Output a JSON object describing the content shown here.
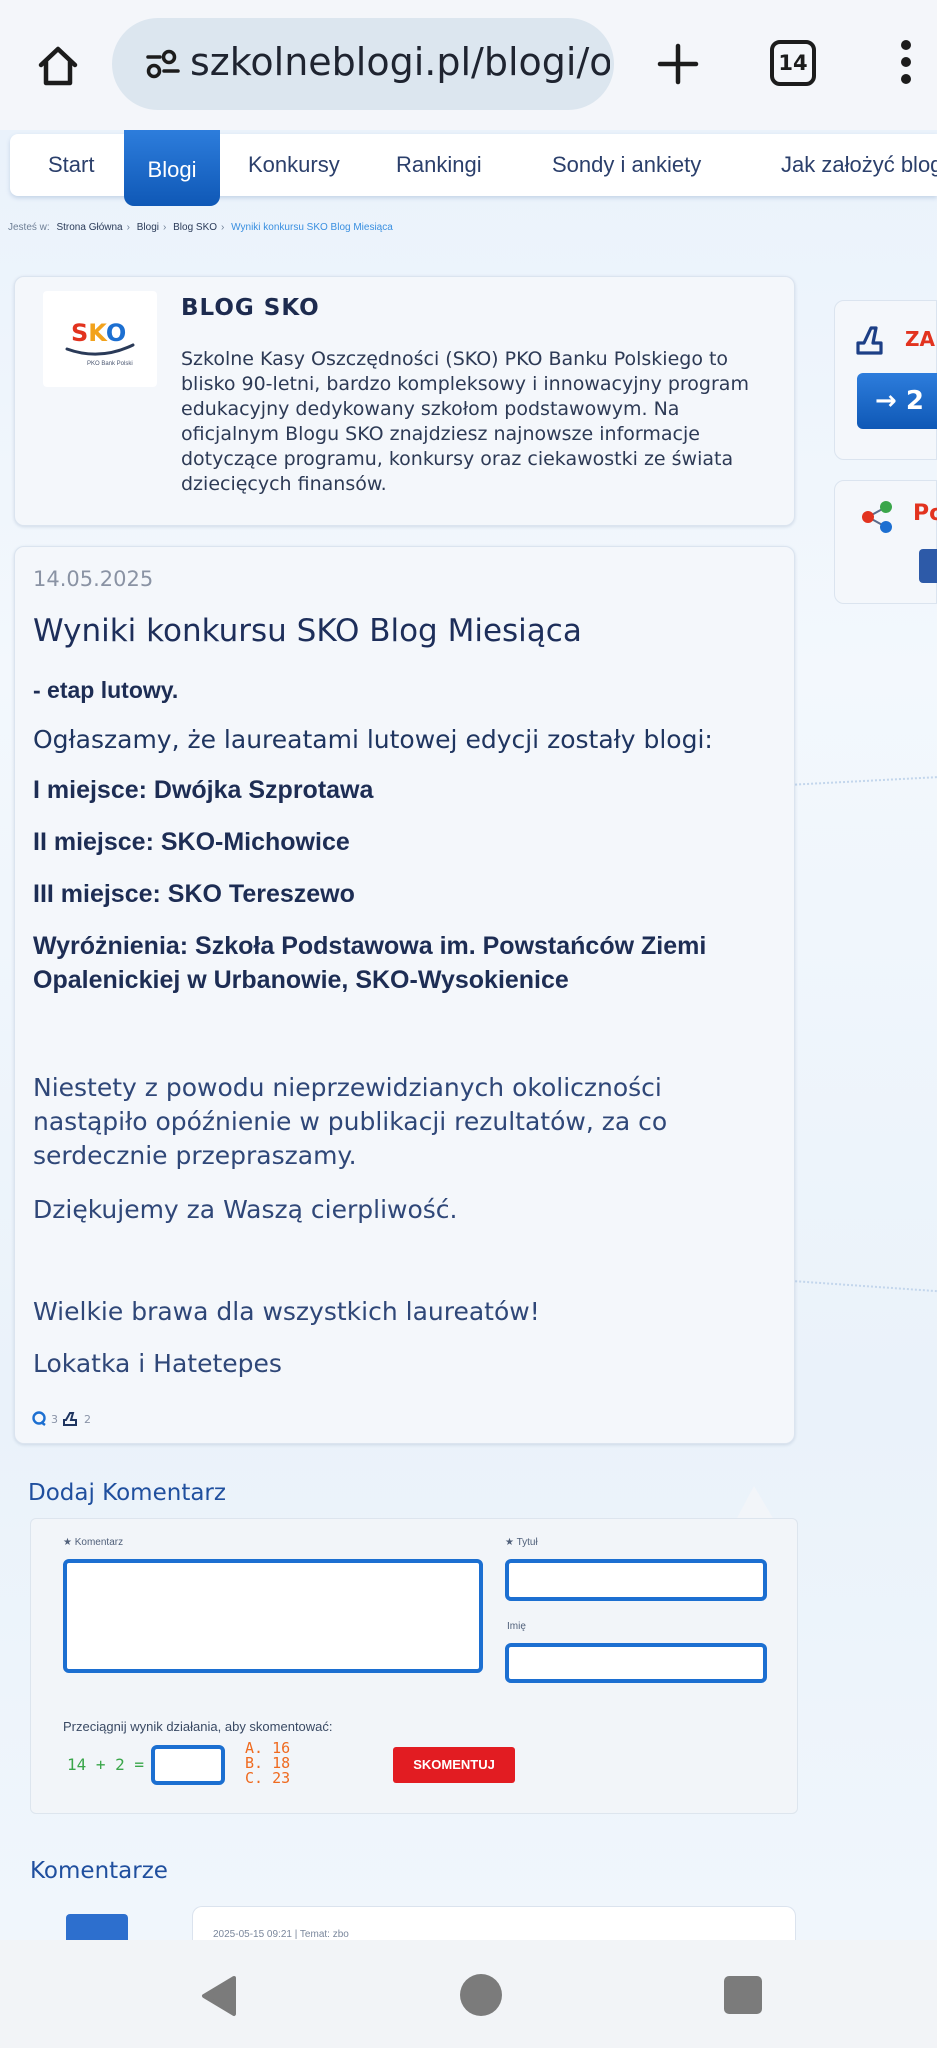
{
  "browser": {
    "url": "szkolneblogi.pl/blogi/o-",
    "tab_count": "14"
  },
  "nav": {
    "items": [
      "Start",
      "Blogi",
      "Konkursy",
      "Rankingi",
      "Sondy i ankiety",
      "Jak założyć blog"
    ],
    "active": "Blogi"
  },
  "breadcrumb": {
    "prefix": "Jesteś w:",
    "items": [
      "Strona Główna",
      "Blogi",
      "Blog SKO"
    ],
    "current": "Wyniki konkursu SKO Blog Miesiąca"
  },
  "blog": {
    "logo_text": "SKO",
    "logo_sub": "PKO Bank Polski",
    "title": "BLOG SKO",
    "description": "Szkolne Kasy Oszczędności (SKO) PKO Banku Polskiego to blisko 90-letni, bardzo kompleksowy i innowacyjny program edukacyjny dedykowany szkołom podstawowym. Na oficjalnym Blogu SKO znajdziesz najnowsze informacje dotyczące programu, konkursy oraz ciekawostki ze świata dziecięcych finansów."
  },
  "post": {
    "date": "14.05.2025",
    "title": "Wyniki konkursu SKO Blog Miesiąca",
    "subtitle": "- etap lutowy.",
    "intro": "Ogłaszamy, że laureatami lutowej edycji zostały blogi:",
    "place1": "I miejsce: Dwójka Szprotawa",
    "place2": "II miejsce: SKO-Michowice",
    "place3": "III miejsce:  SKO Tereszewo",
    "honorable": "Wyróżnienia: Szkoła Podstawowa im. Powstańców Ziemi Opalenickiej w Urbanowie, SKO-Wysokienice",
    "apology": "Niestety z powodu nieprzewidzianych okoliczności nastąpiło opóźnienie w publikacji rezultatów, za co serdecznie przepraszamy.",
    "thanks": "Dziękujemy za Waszą cierpliwość.",
    "congrats": "Wielkie brawa dla wszystkich laureatów!",
    "signature": "Lokatka i Hatetepes",
    "comment_count": "3",
    "like_count": "2"
  },
  "sidebar": {
    "like_label": "ZA",
    "like_button": "→ 2",
    "share_label": "Po"
  },
  "comment_form": {
    "heading": "Dodaj Komentarz",
    "comment_label": "Komentarz",
    "title_label": "Tytuł",
    "name_label": "Imię",
    "captcha_label": "Przeciągnij wynik działania, aby skomentować:",
    "captcha_equation": "14 + 2 =",
    "answers": [
      "A. 16",
      "B. 18",
      "C. 23"
    ],
    "submit": "SKOMENTUJ"
  },
  "comments": {
    "heading": "Komentarze",
    "first_meta": "2025-05-15 09:21 | Temat: zbo"
  },
  "colors": {
    "accent_blue": "#1c6fd1",
    "nav_active": "#0f58b6",
    "submit_red": "#e21c22",
    "captcha_green": "#3aa64a",
    "answer_orange": "#ef6a1f"
  }
}
